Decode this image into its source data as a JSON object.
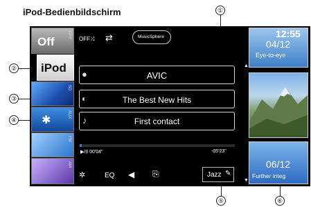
{
  "caption": "iPod-Bedienbildschirm",
  "callouts": [
    "①",
    "②",
    "③",
    "④",
    "⑤",
    "⑥"
  ],
  "clock": "12:55",
  "sources": [
    {
      "label": "Off",
      "tab": "OFF"
    },
    {
      "label": "iPod",
      "tab": ""
    },
    {
      "label": "",
      "tab": "SD"
    },
    {
      "label": "",
      "tab": "AUX"
    },
    {
      "label": "",
      "tab": "FM"
    },
    {
      "label": "",
      "tab": "AM"
    }
  ],
  "top_bar": {
    "shuffle": "OFF⤨",
    "musicsphere": "MusicSphere"
  },
  "info": {
    "artist": "AVIC",
    "album": "The Best New Hits",
    "song": "First contact"
  },
  "playback": {
    "elapsed": "▶/II 00'04\"",
    "remaining": "-05'23\"",
    "progress": 0.015
  },
  "bottom_bar": {
    "eq": "EQ",
    "genre": "Jazz"
  },
  "thumbnails": [
    {
      "date": "04/12",
      "caption": "Eye-to-eye"
    },
    {
      "date": "",
      "caption": ""
    },
    {
      "date": "06/12",
      "caption": "Further integ"
    }
  ]
}
